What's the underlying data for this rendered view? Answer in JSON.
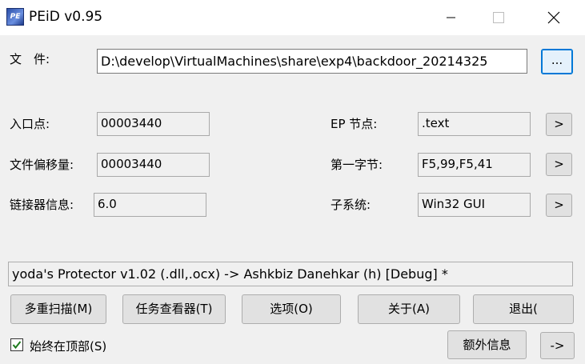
{
  "window": {
    "title": "PEiD v0.95",
    "icon_text": "PE",
    "icons": {
      "app": "peid-app-icon",
      "minimize": "minimize-icon",
      "maximize": "maximize-icon",
      "close": "close-icon"
    }
  },
  "file": {
    "label": "文　件:",
    "path": "D:\\develop\\VirtualMachines\\share\\exp4\\backdoor_20214325",
    "browse_label": "..."
  },
  "fields": {
    "entry_point": {
      "label": "入口点:",
      "value": "00003440"
    },
    "file_offset": {
      "label": "文件偏移量:",
      "value": "00003440"
    },
    "linker_info": {
      "label": "链接器信息:",
      "value": "6.0"
    },
    "ep_section": {
      "label": "EP 节点:",
      "value": ".text",
      "button": ">"
    },
    "first_bytes": {
      "label": "第一字节:",
      "value": "F5,99,F5,41",
      "button": ">"
    },
    "subsystem": {
      "label": "子系统:",
      "value": "Win32 GUI",
      "button": ">"
    }
  },
  "result": "yoda's Protector v1.02 (.dll,.ocx) -> Ashkbiz Danehkar (h) [Debug] *",
  "buttons": {
    "multi_scan": "多重扫描(M)",
    "task_viewer": "任务查看器(T)",
    "options": "选项(O)",
    "about": "关于(A)",
    "exit": "退出(",
    "extra_info": "额外信息",
    "more": "->"
  },
  "always_on_top": {
    "label": "始终在顶部(S)",
    "checked": true
  }
}
